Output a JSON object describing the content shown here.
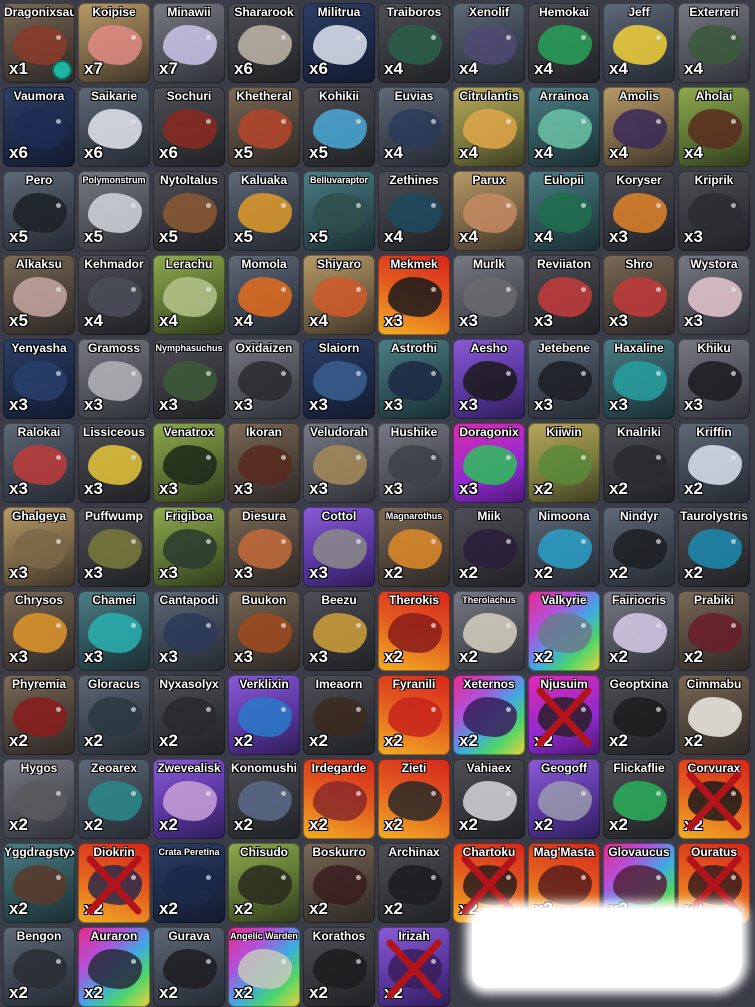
{
  "inventory": [
    {
      "name": "Dragonixsauria",
      "count": "x1",
      "bg": "bg-brown",
      "art": "#8c3b2a",
      "badge": true
    },
    {
      "name": "Koipise",
      "count": "x7",
      "bg": "bg-tan",
      "art": "#e08b82"
    },
    {
      "name": "Minawii",
      "count": "x7",
      "bg": "bg-gray",
      "art": "#c9c6e8"
    },
    {
      "name": "Shararook",
      "count": "x6",
      "bg": "bg-dark",
      "art": "#c0b7a8"
    },
    {
      "name": "Militrua",
      "count": "x6",
      "bg": "bg-blue",
      "art": "#dfe6f2"
    },
    {
      "name": "Traiboros",
      "count": "x4",
      "bg": "bg-dark",
      "art": "#2a6048"
    },
    {
      "name": "Xenolif",
      "count": "x4",
      "bg": "bg-slate",
      "art": "#4e4a72"
    },
    {
      "name": "Hemokai",
      "count": "x4",
      "bg": "bg-dark",
      "art": "#27a158"
    },
    {
      "name": "Jeff",
      "count": "x4",
      "bg": "bg-slate",
      "art": "#f2d13a"
    },
    {
      "name": "Exterreri",
      "count": "x4",
      "bg": "bg-gray",
      "art": "#3b5a3c"
    },
    {
      "name": "Vaumora",
      "count": "x6",
      "bg": "bg-blue",
      "art": "#1f2c54"
    },
    {
      "name": "Saikarie",
      "count": "x6",
      "bg": "bg-slate",
      "art": "#e5e7ef"
    },
    {
      "name": "Sochuri",
      "count": "x6",
      "bg": "bg-dark",
      "art": "#8c2a22"
    },
    {
      "name": "Khetheral",
      "count": "x5",
      "bg": "bg-brown",
      "art": "#b6452a"
    },
    {
      "name": "Kohikii",
      "count": "x5",
      "bg": "bg-dark",
      "art": "#4aa9d8"
    },
    {
      "name": "Euvias",
      "count": "x4",
      "bg": "bg-slate",
      "art": "#2b3b5b"
    },
    {
      "name": "Citrulantis",
      "count": "x4",
      "bg": "bg-lime",
      "art": "#e0a648"
    },
    {
      "name": "Arrainoa",
      "count": "x4",
      "bg": "bg-teal",
      "art": "#6bc4a6"
    },
    {
      "name": "Amolis",
      "count": "x4",
      "bg": "bg-tan",
      "art": "#3a2a58"
    },
    {
      "name": "Aholai",
      "count": "x4",
      "bg": "bg-green",
      "art": "#5b2b1e"
    },
    {
      "name": "Pero",
      "count": "x5",
      "bg": "bg-slate",
      "art": "#1d2026"
    },
    {
      "name": "Polymonstrum",
      "count": "x5",
      "bg": "bg-gray",
      "art": "#d2d6dc",
      "small": true
    },
    {
      "name": "Nytoltalus",
      "count": "x5",
      "bg": "bg-dark",
      "art": "#8c5a34"
    },
    {
      "name": "Kaluaka",
      "count": "x5",
      "bg": "bg-slate",
      "art": "#e09a2a"
    },
    {
      "name": "Belluvaraptor",
      "count": "x5",
      "bg": "bg-teal",
      "art": "#2f4f4a",
      "small": true
    },
    {
      "name": "Zethines",
      "count": "x4",
      "bg": "bg-dark",
      "art": "#1c4a5e"
    },
    {
      "name": "Parux",
      "count": "x4",
      "bg": "bg-tan",
      "art": "#c58a62"
    },
    {
      "name": "Eulopii",
      "count": "x4",
      "bg": "bg-teal",
      "art": "#1f6e4e"
    },
    {
      "name": "Koryser",
      "count": "x3",
      "bg": "bg-dark",
      "art": "#e0832a"
    },
    {
      "name": "Kriprik",
      "count": "x3",
      "bg": "bg-dark",
      "art": "#2b2d33"
    },
    {
      "name": "Alkaksu",
      "count": "x5",
      "bg": "bg-brown",
      "art": "#c4a7a0"
    },
    {
      "name": "Kehmador",
      "count": "x4",
      "bg": "bg-dark",
      "art": "#4a4e58"
    },
    {
      "name": "Lerachu",
      "count": "x4",
      "bg": "bg-green",
      "art": "#b6c48a"
    },
    {
      "name": "Momola",
      "count": "x4",
      "bg": "bg-slate",
      "art": "#e36c1e"
    },
    {
      "name": "Shiyaro",
      "count": "x4",
      "bg": "bg-tan",
      "art": "#d25a2a"
    },
    {
      "name": "Mekmek",
      "count": "x3",
      "bg": "bg-fire",
      "art": "#1c1c1c"
    },
    {
      "name": "Murlk",
      "count": "x3",
      "bg": "bg-gray",
      "art": "#6a6a6e"
    },
    {
      "name": "Reviiaton",
      "count": "x3",
      "bg": "bg-dark",
      "art": "#c63c3c"
    },
    {
      "name": "Shro",
      "count": "x3",
      "bg": "bg-brown",
      "art": "#c23a3a"
    },
    {
      "name": "Wystora",
      "count": "x3",
      "bg": "bg-gray",
      "art": "#e7c7cf"
    },
    {
      "name": "Yenyasha",
      "count": "x3",
      "bg": "bg-blue",
      "art": "#2a3f6e"
    },
    {
      "name": "Gramoss",
      "count": "x3",
      "bg": "bg-gray",
      "art": "#b2b4b8"
    },
    {
      "name": "Nymphasuchus",
      "count": "x3",
      "bg": "bg-dark",
      "art": "#3c5a3a",
      "small": true
    },
    {
      "name": "Oxidaizen",
      "count": "x3",
      "bg": "bg-gray",
      "art": "#2a2b2f"
    },
    {
      "name": "Slaiorn",
      "count": "x3",
      "bg": "bg-blue",
      "art": "#3a5f8f"
    },
    {
      "name": "Astrothi",
      "count": "x3",
      "bg": "bg-teal",
      "art": "#1f2a44"
    },
    {
      "name": "Aesho",
      "count": "x3",
      "bg": "bg-purple",
      "art": "#1a1a1a"
    },
    {
      "name": "Jetebene",
      "count": "x3",
      "bg": "bg-slate",
      "art": "#1d1f25"
    },
    {
      "name": "Haxaline",
      "count": "x3",
      "bg": "bg-teal",
      "art": "#27a0a0"
    },
    {
      "name": "Khiku",
      "count": "x3",
      "bg": "bg-gray",
      "art": "#1c1c20"
    },
    {
      "name": "Ralokai",
      "count": "x3",
      "bg": "bg-slate",
      "art": "#c03c3c"
    },
    {
      "name": "Lissiceous",
      "count": "x3",
      "bg": "bg-dark",
      "art": "#e6c53a"
    },
    {
      "name": "Venatrox",
      "count": "x3",
      "bg": "bg-green",
      "art": "#1c2a1a"
    },
    {
      "name": "Ikoran",
      "count": "x3",
      "bg": "bg-brown",
      "art": "#5a2a1e"
    },
    {
      "name": "Veludorah",
      "count": "x3",
      "bg": "bg-gray",
      "art": "#a68a5a"
    },
    {
      "name": "Hushike",
      "count": "x3",
      "bg": "bg-gray",
      "art": "#3e4148"
    },
    {
      "name": "Doragonix",
      "count": "x3",
      "bg": "bg-magenta",
      "art": "#2ec05a"
    },
    {
      "name": "Kiiwin",
      "count": "x2",
      "bg": "bg-lime",
      "art": "#5a8a3a"
    },
    {
      "name": "Knalriki",
      "count": "x2",
      "bg": "bg-dark",
      "art": "#2a2b30"
    },
    {
      "name": "Kriffin",
      "count": "x2",
      "bg": "bg-slate",
      "art": "#dce4f0"
    },
    {
      "name": "Ghalgeya",
      "count": "x3",
      "bg": "bg-tan",
      "art": "#7a6848"
    },
    {
      "name": "Puffwump",
      "count": "x3",
      "bg": "bg-dark",
      "art": "#7a7a3a"
    },
    {
      "name": "Frigiboa",
      "count": "x3",
      "bg": "bg-green",
      "art": "#2a3a2e"
    },
    {
      "name": "Diesura",
      "count": "x3",
      "bg": "bg-brown",
      "art": "#c46a3a"
    },
    {
      "name": "Cottol",
      "count": "x3",
      "bg": "bg-purple",
      "art": "#8a8a8a"
    },
    {
      "name": "Magnarothus",
      "count": "x2",
      "bg": "bg-brown",
      "art": "#e08a2a",
      "small": true
    },
    {
      "name": "Miik",
      "count": "x2",
      "bg": "bg-dark",
      "art": "#2b1e3a"
    },
    {
      "name": "Nimoona",
      "count": "x2",
      "bg": "bg-slate",
      "art": "#2aa0c8"
    },
    {
      "name": "Nindyr",
      "count": "x2",
      "bg": "bg-slate",
      "art": "#1c1e22"
    },
    {
      "name": "Taurolystris",
      "count": "x2",
      "bg": "bg-dark",
      "art": "#1c8ab0"
    },
    {
      "name": "Chrysos",
      "count": "x3",
      "bg": "bg-brown",
      "art": "#e0962a"
    },
    {
      "name": "Chamei",
      "count": "x3",
      "bg": "bg-teal",
      "art": "#2ab0b0"
    },
    {
      "name": "Cantapodi",
      "count": "x3",
      "bg": "bg-slate",
      "art": "#2c3a5a"
    },
    {
      "name": "Buukon",
      "count": "x3",
      "bg": "bg-brown",
      "art": "#a04a1e"
    },
    {
      "name": "Beezu",
      "count": "x3",
      "bg": "bg-dark",
      "art": "#d0a03a"
    },
    {
      "name": "Therokis",
      "count": "x2",
      "bg": "bg-fire",
      "art": "#8a1c1c"
    },
    {
      "name": "Therolachus",
      "count": "x2",
      "bg": "bg-gray",
      "art": "#d6d0c0",
      "small": true
    },
    {
      "name": "Valkyrie",
      "count": "x2",
      "bg": "bg-rainbow",
      "art": "#6a7a8a"
    },
    {
      "name": "Fairiocris",
      "count": "x2",
      "bg": "bg-gray",
      "art": "#d8ccea"
    },
    {
      "name": "Prabiki",
      "count": "x2",
      "bg": "bg-brown",
      "art": "#6a1e2a"
    },
    {
      "name": "Phyremia",
      "count": "x2",
      "bg": "bg-brown",
      "art": "#8a1c1c"
    },
    {
      "name": "Gloracus",
      "count": "x2",
      "bg": "bg-slate",
      "art": "#2a3a42"
    },
    {
      "name": "Nyxasolyx",
      "count": "x2",
      "bg": "bg-dark",
      "art": "#2a2a2e"
    },
    {
      "name": "Verklixin",
      "count": "x2",
      "bg": "bg-purple",
      "art": "#2a7ac8"
    },
    {
      "name": "Imeaorn",
      "count": "x2",
      "bg": "bg-dark",
      "art": "#3a2a1e"
    },
    {
      "name": "Fyranili",
      "count": "x2",
      "bg": "bg-fire",
      "art": "#c8241c"
    },
    {
      "name": "Xeternos",
      "count": "x2",
      "bg": "bg-rainbow",
      "art": "#3a1e5a"
    },
    {
      "name": "Njusuim",
      "count": "x2",
      "bg": "bg-magenta",
      "art": "#2a1e2a",
      "crossed": true
    },
    {
      "name": "Geoptxina",
      "count": "x2",
      "bg": "bg-dark",
      "art": "#1c1c1e"
    },
    {
      "name": "Cimmabu",
      "count": "x2",
      "bg": "bg-brown",
      "art": "#f0ece4"
    },
    {
      "name": "Hygos",
      "count": "x2",
      "bg": "bg-gray",
      "art": "#5a5a5e"
    },
    {
      "name": "Zeoarex",
      "count": "x2",
      "bg": "bg-slate",
      "art": "#2a8a8a"
    },
    {
      "name": "Zwevealisk",
      "count": "x2",
      "bg": "bg-purple",
      "art": "#c8a0d8"
    },
    {
      "name": "Konomushi",
      "count": "x2",
      "bg": "bg-dark",
      "art": "#5a6a8a"
    },
    {
      "name": "Irdegarde",
      "count": "x2",
      "bg": "bg-fire",
      "art": "#8a2a2a"
    },
    {
      "name": "Zieti",
      "count": "x2",
      "bg": "bg-fire",
      "art": "#2a2a2a"
    },
    {
      "name": "Vahiaex",
      "count": "x2",
      "bg": "bg-dark",
      "art": "#d6d6da"
    },
    {
      "name": "Geogoff",
      "count": "x2",
      "bg": "bg-purple",
      "art": "#9a9aae"
    },
    {
      "name": "Flickaflie",
      "count": "x2",
      "bg": "bg-dark",
      "art": "#2ab05a"
    },
    {
      "name": "Corvurax",
      "count": "x2",
      "bg": "bg-fire",
      "art": "#1c1c1c",
      "crossed": true
    },
    {
      "name": "Yggdragstyx",
      "count": "x2",
      "bg": "bg-teal",
      "art": "#5a3a2a"
    },
    {
      "name": "Diokrin",
      "count": "x2",
      "bg": "bg-fire",
      "art": "#2a2a4a",
      "crossed": true
    },
    {
      "name": "Crata Peretina",
      "count": "x2",
      "bg": "bg-blue",
      "art": "#1c2a4a",
      "small": true
    },
    {
      "name": "Chisudo",
      "count": "x2",
      "bg": "bg-green",
      "art": "#2a2a1e"
    },
    {
      "name": "Boskurro",
      "count": "x2",
      "bg": "bg-brown",
      "art": "#3a1e1e"
    },
    {
      "name": "Archinax",
      "count": "x2",
      "bg": "bg-dark",
      "art": "#1c1c22"
    },
    {
      "name": "Chartoku",
      "count": "x2",
      "bg": "bg-fire",
      "art": "#2a1e1e",
      "crossed": true
    },
    {
      "name": "Mag'Masta",
      "count": "x2",
      "bg": "bg-fire",
      "art": "#5a1e1e"
    },
    {
      "name": "Glovaucus",
      "count": "x2",
      "bg": "bg-rainbow",
      "art": "#5a1e3a"
    },
    {
      "name": "Ouratus",
      "count": "x2",
      "bg": "bg-fire",
      "art": "#3a1e1e",
      "crossed": true
    },
    {
      "name": "Bengon",
      "count": "x2",
      "bg": "bg-slate",
      "art": "#2a2e34"
    },
    {
      "name": "Auraron",
      "count": "x2",
      "bg": "bg-rainbow",
      "art": "#2a2a3a"
    },
    {
      "name": "Gurava",
      "count": "x2",
      "bg": "bg-slate",
      "art": "#1e1e22"
    },
    {
      "name": "Angelic Warden",
      "count": "x2",
      "bg": "bg-rainbow",
      "art": "#c8c8b8",
      "small": true
    },
    {
      "name": "Korathos",
      "count": "x2",
      "bg": "bg-dark",
      "art": "#1c1c1e"
    },
    {
      "name": "Irizah",
      "count": "x2",
      "bg": "bg-purple",
      "art": "#3a1e5a",
      "crossed": true
    }
  ],
  "colors": {
    "background": "#3a3c47",
    "cross": "#b3141c",
    "redaction": "#ffffff"
  }
}
